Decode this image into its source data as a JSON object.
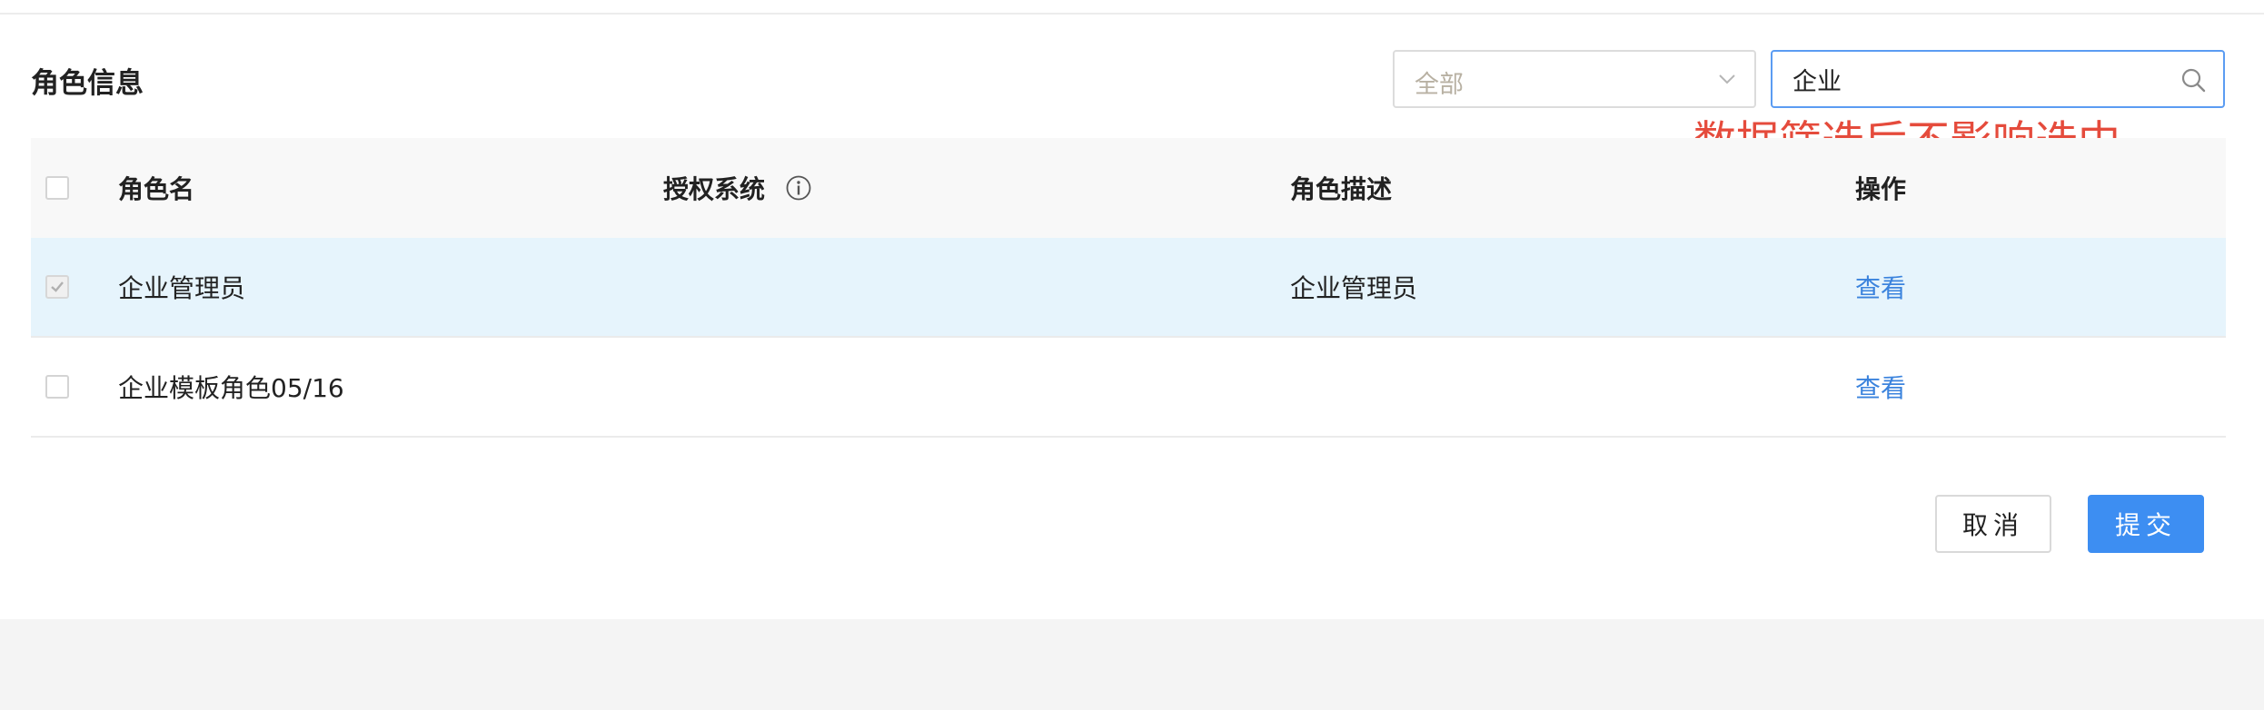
{
  "section": {
    "title": "角色信息"
  },
  "filter": {
    "select_value": "全部",
    "search_value": "企业"
  },
  "annotation": "数据筛选后不影响选中",
  "table": {
    "headers": {
      "name": "角色名",
      "system": "授权系统",
      "description": "角色描述",
      "actions": "操作"
    },
    "rows": [
      {
        "checked": true,
        "disabled": true,
        "name": "企业管理员",
        "system": "",
        "description": "企业管理员",
        "action": "查看"
      },
      {
        "checked": false,
        "disabled": false,
        "name": "企业模板角色05/16",
        "system": "",
        "description": "",
        "action": "查看"
      }
    ]
  },
  "buttons": {
    "cancel": "取消",
    "submit": "提交"
  },
  "colors": {
    "accent": "#3d8ef2",
    "link": "#3b83dd",
    "annotation": "#e54b3c",
    "selected_row": "#e6f4fc"
  },
  "icons": {
    "select_chevron": "chevron-down-icon",
    "search": "search-icon",
    "info": "info-icon",
    "check": "check-icon"
  }
}
